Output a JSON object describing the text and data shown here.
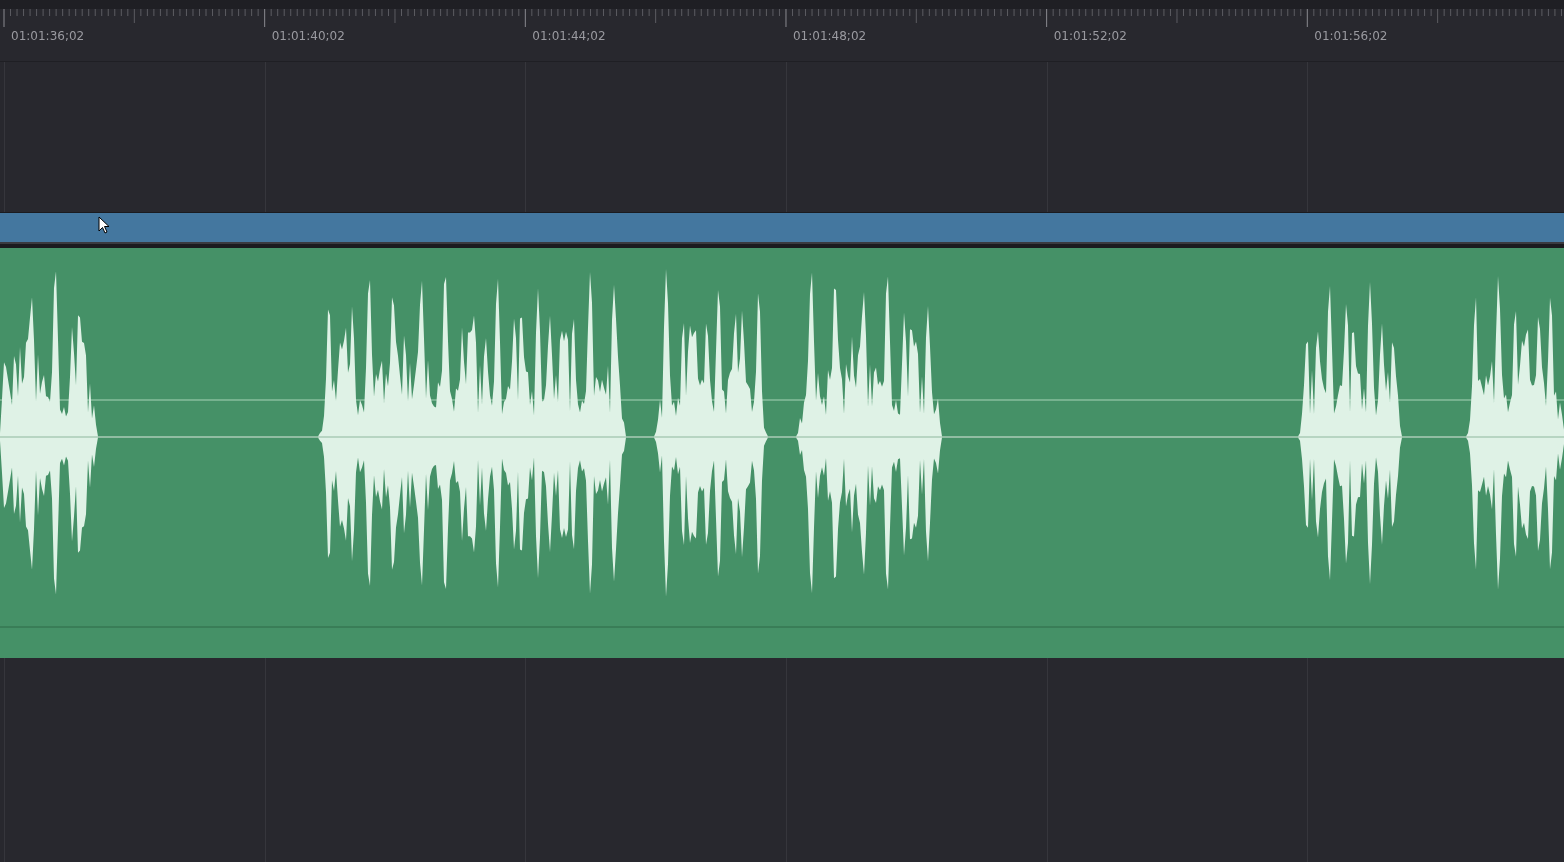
{
  "ruler": {
    "timecodes": [
      "01:01:36;02",
      "01:01:40;02",
      "01:01:44;02",
      "01:01:48;02",
      "01:01:52;02",
      "01:01:56;02"
    ]
  }
}
